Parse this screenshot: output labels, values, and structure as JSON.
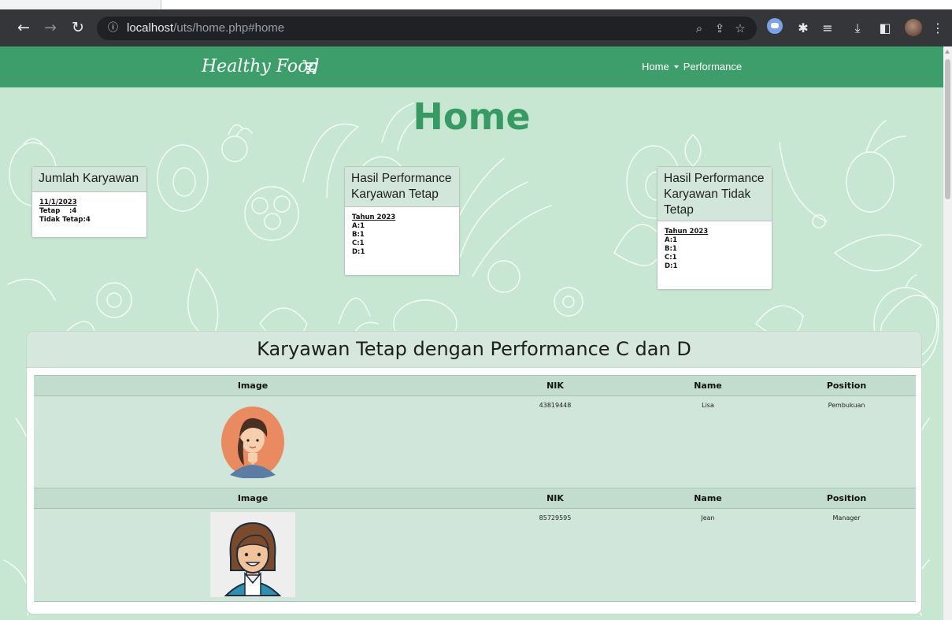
{
  "browser": {
    "url_host": "localhost",
    "url_path": "/uts/home.php#home"
  },
  "navbar": {
    "brand": "Healthy Food",
    "links": [
      "Home",
      "Performance"
    ]
  },
  "page": {
    "title": "Home"
  },
  "cards": {
    "jumlah": {
      "title": "Jumlah Karyawan",
      "date": "11/1/2023",
      "tetap_label": "Tetap",
      "tetap_value": ":4",
      "tidak_label": "Tidak Tetap",
      "tidak_value": ":4"
    },
    "tetap": {
      "title_line1": "Hasil Performance",
      "title_line2": "Karyawan Tetap",
      "year": "Tahun 2023",
      "grades": [
        "A:1",
        "B:1",
        "C:1",
        "D:1"
      ]
    },
    "tidak_tetap": {
      "title_line1": "Hasil Performance",
      "title_line2": "Karyawan Tidak",
      "title_line3": "Tetap",
      "year": "Tahun 2023",
      "grades": [
        "A:1",
        "B:1",
        "C:1",
        "D:1"
      ]
    }
  },
  "section": {
    "title": "Karyawan Tetap dengan Performance C dan D",
    "headers": [
      "Image",
      "NIK",
      "Name",
      "Position"
    ],
    "rows": [
      {
        "nik": "43819448",
        "name": "Lisa",
        "position": "Pembukuan"
      },
      {
        "nik": "85729595",
        "name": "Jean",
        "position": "Manager"
      }
    ]
  },
  "colors": {
    "navbar": "#3d9e6b",
    "title": "#379a63",
    "page_bg": "#c8e7d3"
  }
}
